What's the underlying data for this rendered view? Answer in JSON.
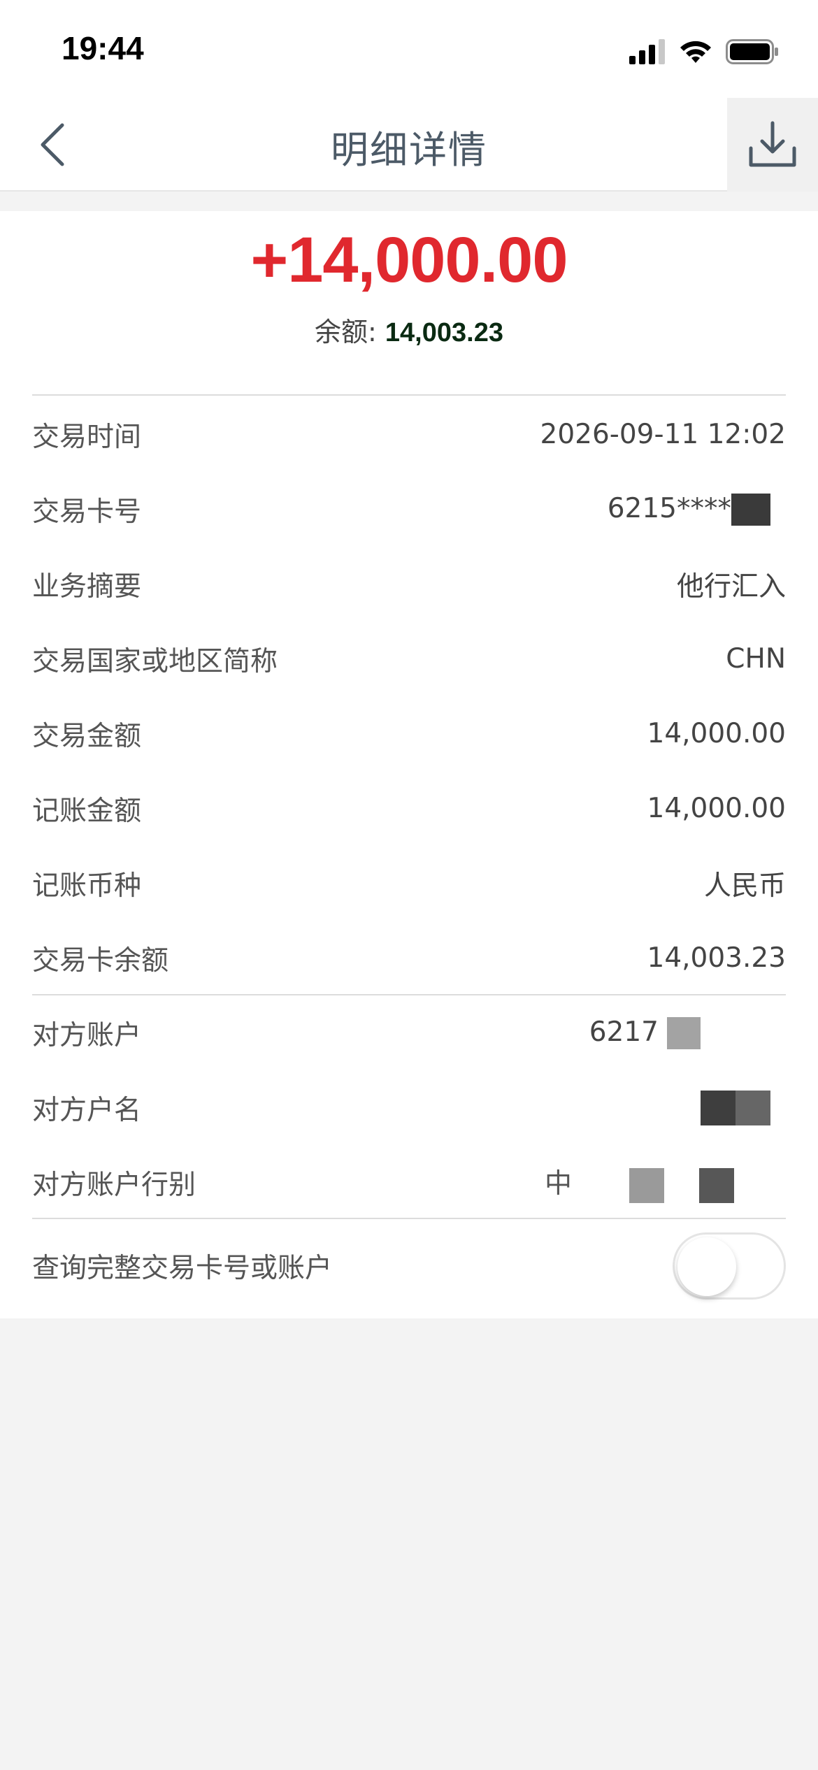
{
  "status_bar": {
    "time": "19:44"
  },
  "nav": {
    "title": "明细详情"
  },
  "summary": {
    "amount": "+14,000.00",
    "balance_label": "余额: ",
    "balance_value": "14,003.23"
  },
  "details": [
    {
      "label": "交易时间",
      "value": "2026-09-11 12:02"
    },
    {
      "label": "交易卡号",
      "value": "6215****"
    },
    {
      "label": "业务摘要",
      "value": "他行汇入"
    },
    {
      "label": "交易国家或地区简称",
      "value": "CHN"
    },
    {
      "label": "交易金额",
      "value": "14,000.00"
    },
    {
      "label": "记账金额",
      "value": "14,000.00"
    },
    {
      "label": "记账币种",
      "value": "人民币"
    },
    {
      "label": "交易卡余额",
      "value": "14,003.23"
    }
  ],
  "counterparty": [
    {
      "label": "对方账户",
      "value": "6217"
    },
    {
      "label": "对方户名",
      "value": ""
    },
    {
      "label": "对方账户行别",
      "value": "中"
    }
  ],
  "toggle_row": {
    "label": "查询完整交易卡号或账户",
    "enabled": false
  },
  "colors": {
    "amount": "#e0282e",
    "title": "#4c5a67",
    "background": "#f3f3f3"
  },
  "icons": {
    "back": "chevron-left-icon",
    "download": "download-icon",
    "signal": "cellular-signal-icon",
    "wifi": "wifi-icon",
    "battery": "battery-icon"
  }
}
